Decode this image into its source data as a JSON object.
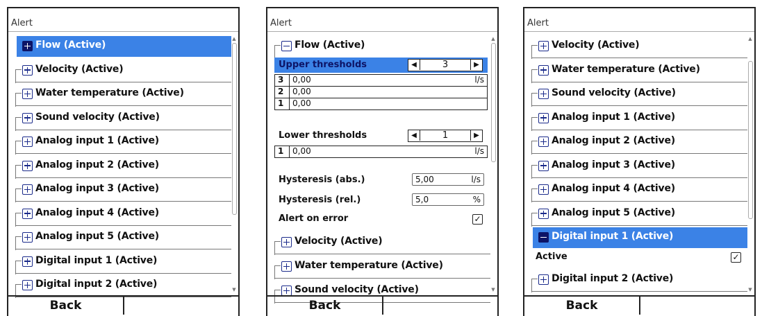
{
  "panels": [
    {
      "title": "Alert",
      "items": [
        {
          "label": "Flow (Active)",
          "selected": true,
          "expanded": false
        },
        {
          "label": "Velocity (Active)"
        },
        {
          "label": "Water temperature (Active)"
        },
        {
          "label": "Sound velocity (Active)"
        },
        {
          "label": "Analog input 1 (Active)"
        },
        {
          "label": "Analog input 2 (Active)"
        },
        {
          "label": "Analog input 3 (Active)"
        },
        {
          "label": "Analog input 4 (Active)"
        },
        {
          "label": "Analog input 5 (Active)"
        },
        {
          "label": "Digital input 1 (Active)"
        },
        {
          "label": "Digital input 2 (Active)"
        }
      ],
      "back_label": "Back"
    },
    {
      "title": "Alert",
      "expanded_item": "Flow (Active)",
      "upper_thresholds": {
        "label": "Upper thresholds",
        "count": "3",
        "rows": [
          {
            "index": "3",
            "value": "0,00",
            "unit": "l/s"
          },
          {
            "index": "2",
            "value": "0,00",
            "unit": ""
          },
          {
            "index": "1",
            "value": "0,00",
            "unit": ""
          }
        ]
      },
      "lower_thresholds": {
        "label": "Lower thresholds",
        "count": "1",
        "rows": [
          {
            "index": "1",
            "value": "0,00",
            "unit": "l/s"
          }
        ]
      },
      "hysteresis_abs": {
        "label": "Hysteresis (abs.)",
        "value": "5,00",
        "unit": "l/s"
      },
      "hysteresis_rel": {
        "label": "Hysteresis (rel.)",
        "value": "5,0",
        "unit": "%"
      },
      "alert_on_error": {
        "label": "Alert on error",
        "checked": "✓"
      },
      "items_after": [
        "Velocity (Active)",
        "Water temperature (Active)",
        "Sound velocity (Active)"
      ],
      "back_label": "Back"
    },
    {
      "title": "Alert",
      "items_before": [
        "Velocity (Active)",
        "Water temperature (Active)",
        "Sound velocity (Active)",
        "Analog input 1 (Active)",
        "Analog input 2 (Active)",
        "Analog input 3 (Active)",
        "Analog input 4 (Active)",
        "Analog input 5 (Active)"
      ],
      "expanded_item": "Digital input 1 (Active)",
      "active": {
        "label": "Active",
        "checked": "✓"
      },
      "items_after": [
        "Digital input 2 (Active)"
      ],
      "back_label": "Back"
    }
  ],
  "icons": {
    "expand": "plus-box-icon",
    "collapse": "minus-box-icon",
    "left": "◀",
    "right": "▶",
    "scroll_up": "▲",
    "scroll_down": "▼"
  },
  "colors": {
    "selection": "#3b82e6",
    "selected_text": "#ffffff",
    "icon_dark": "#0d1466"
  }
}
